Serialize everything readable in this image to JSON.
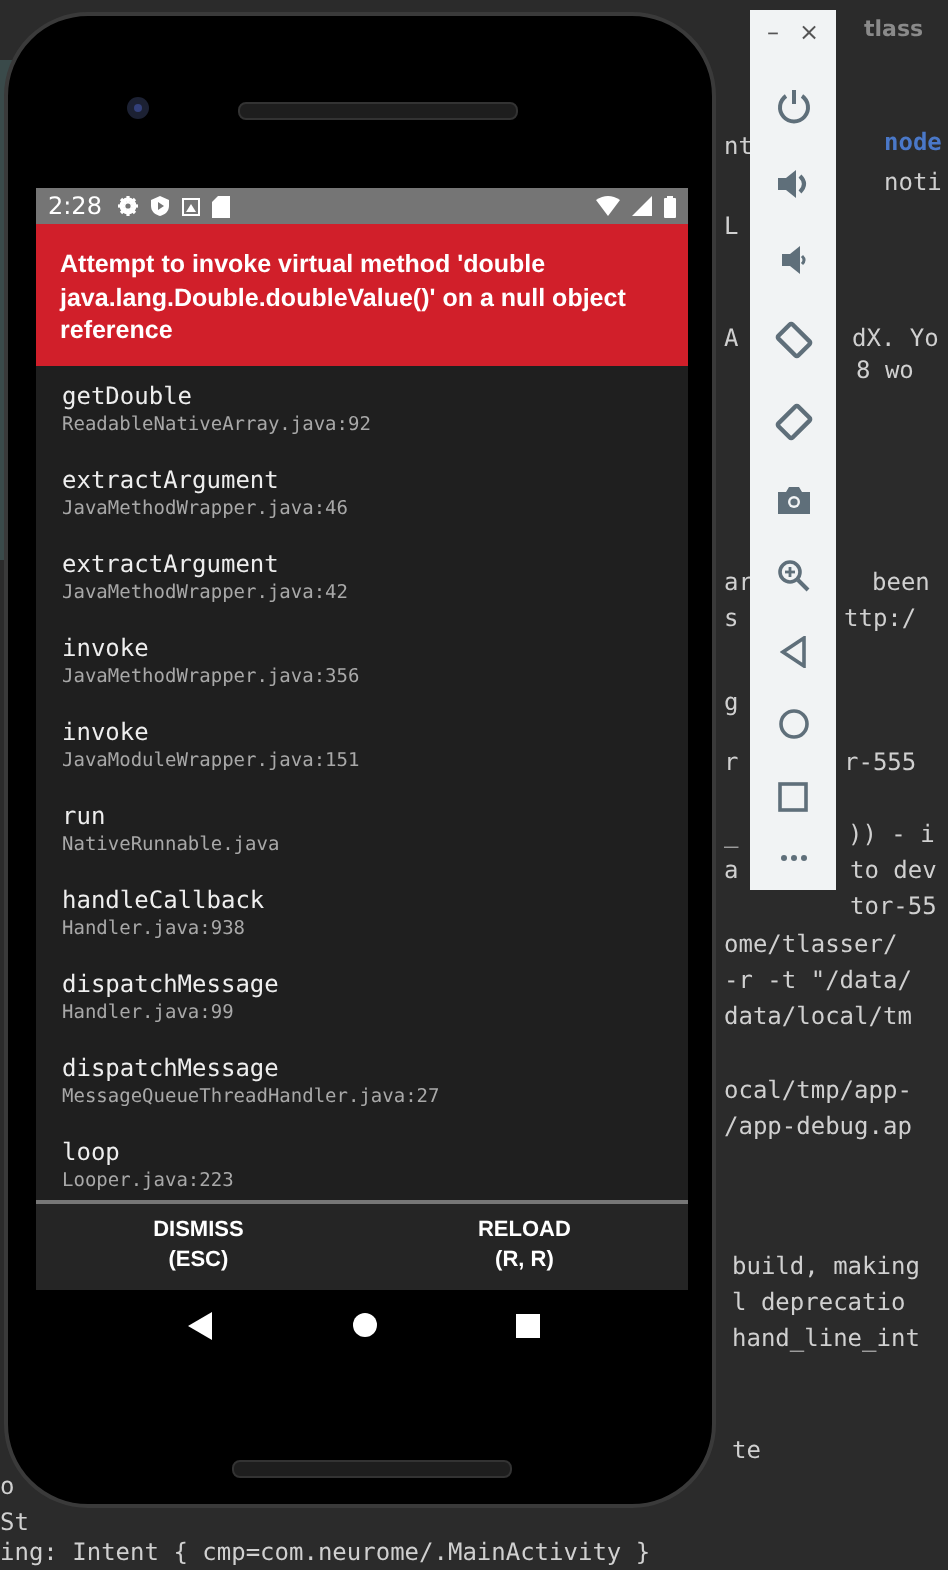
{
  "terminal": {
    "title": "tlass",
    "fragments": [
      {
        "text": "nt",
        "kind": "plain"
      },
      {
        "text": "node",
        "kind": "keyword"
      },
      {
        "text": "noti",
        "kind": "plain"
      },
      {
        "text": "L",
        "kind": "plain"
      },
      {
        "text": "A",
        "kind": "plain"
      },
      {
        "text": "dX. Yo",
        "kind": "plain"
      },
      {
        "text": "8 wo",
        "kind": "plain"
      },
      {
        "text": "ar",
        "kind": "plain"
      },
      {
        "text": "been",
        "kind": "plain"
      },
      {
        "text": "s",
        "kind": "plain"
      },
      {
        "text": "ttp:/",
        "kind": "plain"
      },
      {
        "text": "g",
        "kind": "plain"
      },
      {
        "text": "r",
        "kind": "plain"
      },
      {
        "text": "r-555",
        "kind": "plain"
      },
      {
        "text": "_",
        "kind": "plain"
      },
      {
        "text": ")) - i",
        "kind": "plain"
      },
      {
        "text": "a",
        "kind": "plain"
      },
      {
        "text": "to dev",
        "kind": "plain"
      },
      {
        "text": "tor-55",
        "kind": "plain"
      },
      {
        "text": "ome/tlasser/",
        "kind": "plain"
      },
      {
        "text": "-r -t \"/data/",
        "kind": "plain"
      },
      {
        "text": "data/local/tm",
        "kind": "plain"
      },
      {
        "text": "ocal/tmp/app-",
        "kind": "plain"
      },
      {
        "text": "/app-debug.ap",
        "kind": "plain"
      },
      {
        "text": "build, making",
        "kind": "plain"
      },
      {
        "text": "l deprecatio",
        "kind": "plain"
      },
      {
        "text": "hand_line_int",
        "kind": "plain"
      },
      {
        "text": "te",
        "kind": "plain"
      },
      {
        "text": "o",
        "kind": "plain"
      },
      {
        "text": "St",
        "kind": "plain"
      },
      {
        "text": "ing: Intent { cmp=com.neurome/.MainActivity }",
        "kind": "plain"
      }
    ]
  },
  "emulator_toolbar": {
    "minimize": "–",
    "close": "×"
  },
  "phone": {
    "status_bar": {
      "time": "2:28"
    },
    "error": {
      "message": "Attempt to invoke virtual method 'double java.lang.Double.doubleValue()' on a null object reference"
    },
    "stack": [
      {
        "method": "getDouble",
        "file": "ReadableNativeArray.java:92"
      },
      {
        "method": "extractArgument",
        "file": "JavaMethodWrapper.java:46"
      },
      {
        "method": "extractArgument",
        "file": "JavaMethodWrapper.java:42"
      },
      {
        "method": "invoke",
        "file": "JavaMethodWrapper.java:356"
      },
      {
        "method": "invoke",
        "file": "JavaModuleWrapper.java:151"
      },
      {
        "method": "run",
        "file": "NativeRunnable.java"
      },
      {
        "method": "handleCallback",
        "file": "Handler.java:938"
      },
      {
        "method": "dispatchMessage",
        "file": "Handler.java:99"
      },
      {
        "method": "dispatchMessage",
        "file": "MessageQueueThreadHandler.java:27"
      },
      {
        "method": "loop",
        "file": "Looper.java:223"
      }
    ],
    "actions": [
      {
        "label": "DISMISS",
        "shortcut": "(ESC)"
      },
      {
        "label": "RELOAD",
        "shortcut": "(R, R)"
      }
    ]
  }
}
